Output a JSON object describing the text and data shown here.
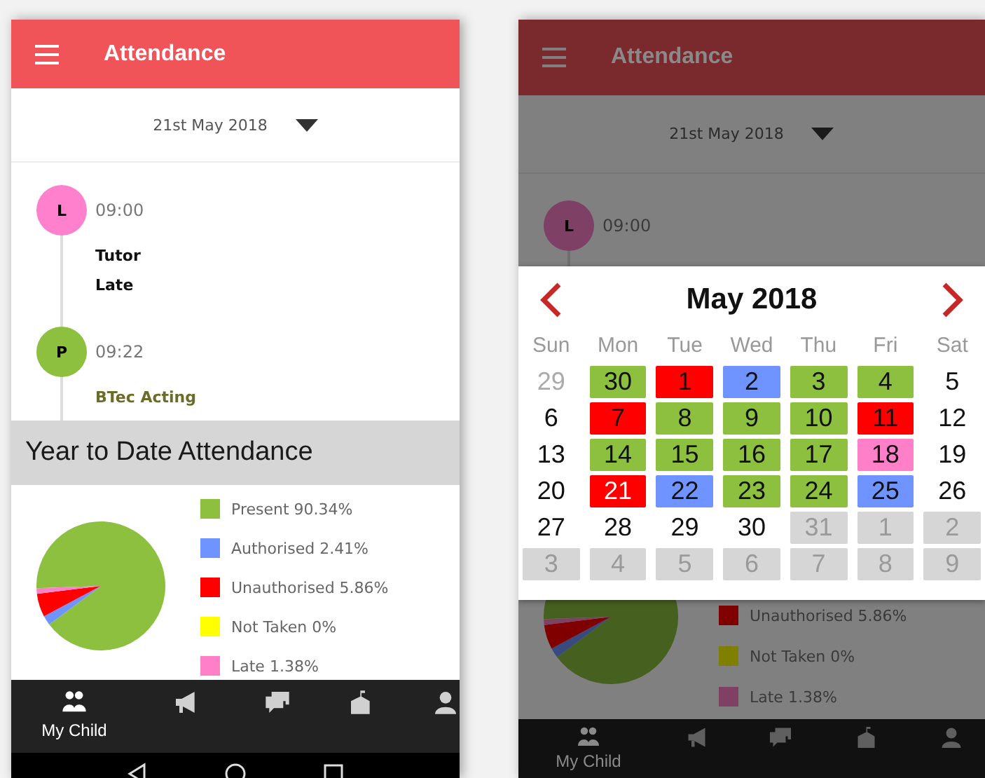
{
  "screens": [
    {
      "dimmed": false,
      "system_nav": true,
      "header": {
        "title": "Attendance"
      },
      "date_picker": {
        "value": "21st May 2018"
      },
      "timeline": [
        {
          "letter": "L",
          "color": "#ff80cc",
          "time": "09:00",
          "details": [
            {
              "kind": "plain",
              "text": "Tutor"
            },
            {
              "kind": "plain",
              "text": "Late"
            }
          ]
        },
        {
          "letter": "P",
          "color": "#8dc03f",
          "time": "09:22",
          "details": [
            {
              "kind": "subject",
              "text": "BTec Acting"
            }
          ]
        }
      ],
      "section_title": "Year to Date Attendance",
      "chart_data": {
        "type": "pie",
        "categories": [
          "Present 90.34%",
          "Authorised 2.41%",
          "Unauthorised 5.86%",
          "Not Taken 0%",
          "Late 1.38%"
        ],
        "values": [
          90.34,
          2.41,
          5.86,
          0,
          1.38
        ]
      },
      "legend": [
        {
          "color": "#8dc03f"
        },
        {
          "color": "#7094ff"
        },
        {
          "color": "#ff0000"
        },
        {
          "color": "#ffff00"
        },
        {
          "color": "#ff80c8"
        }
      ],
      "nav": [
        {
          "kind": "people",
          "label": "My Child",
          "selected": true
        },
        {
          "kind": "megaphone",
          "selected": false
        },
        {
          "kind": "chat",
          "selected": false
        },
        {
          "kind": "school",
          "selected": false
        },
        {
          "kind": "person",
          "selected": false
        }
      ]
    },
    {
      "dimmed": true,
      "system_nav": false,
      "header": {
        "title": "Attendance"
      },
      "date_picker": {
        "value": "21st May 2018"
      },
      "timeline": [
        {
          "letter": "L",
          "color": "#7f4066",
          "time": "09:00"
        }
      ],
      "pie": {
        "kind": "picture"
      },
      "legend": [
        {
          "label": "Unauthorised 5.86%",
          "color": "#800000"
        },
        {
          "label": "Not Taken 0%",
          "color": "#808000"
        },
        {
          "label": "Late 1.38%",
          "color": "#804064"
        }
      ],
      "nav": [
        {
          "kind": "people",
          "label": "My Child",
          "selected": true
        },
        {
          "kind": "megaphone",
          "selected": false
        },
        {
          "kind": "chat",
          "selected": false
        },
        {
          "kind": "school",
          "selected": false
        },
        {
          "kind": "person",
          "selected": false
        }
      ],
      "calendar": {
        "title": "May 2018",
        "weekdays": [
          "Sun",
          "Mon",
          "Tue",
          "Wed",
          "Thu",
          "Fri",
          "Sat"
        ],
        "days": [
          {
            "day": "29",
            "kind": "faded",
            "selected": false
          },
          {
            "day": "30",
            "kind": "marked",
            "color": "#8dc03f",
            "selected": false
          },
          {
            "day": "1",
            "kind": "marked",
            "color": "#ff0000",
            "selected": false
          },
          {
            "day": "2",
            "kind": "marked",
            "color": "#7094ff",
            "selected": false
          },
          {
            "day": "3",
            "kind": "marked",
            "color": "#8dc03f",
            "selected": false
          },
          {
            "day": "4",
            "kind": "marked",
            "color": "#8dc03f",
            "selected": false
          },
          {
            "day": "5",
            "kind": "plain",
            "selected": false
          },
          {
            "day": "6",
            "kind": "plain",
            "selected": false
          },
          {
            "day": "7",
            "kind": "marked",
            "color": "#ff0000",
            "selected": false
          },
          {
            "day": "8",
            "kind": "marked",
            "color": "#8dc03f",
            "selected": false
          },
          {
            "day": "9",
            "kind": "marked",
            "color": "#8dc03f",
            "selected": false
          },
          {
            "day": "10",
            "kind": "marked",
            "color": "#8dc03f",
            "selected": false
          },
          {
            "day": "11",
            "kind": "marked",
            "color": "#ff0000",
            "selected": false
          },
          {
            "day": "12",
            "kind": "plain",
            "selected": false
          },
          {
            "day": "13",
            "kind": "plain",
            "selected": false
          },
          {
            "day": "14",
            "kind": "marked",
            "color": "#8dc03f",
            "selected": false
          },
          {
            "day": "15",
            "kind": "marked",
            "color": "#8dc03f",
            "selected": false
          },
          {
            "day": "16",
            "kind": "marked",
            "color": "#8dc03f",
            "selected": false
          },
          {
            "day": "17",
            "kind": "marked",
            "color": "#8dc03f",
            "selected": false
          },
          {
            "day": "18",
            "kind": "marked",
            "color": "#ff80c8",
            "selected": false
          },
          {
            "day": "19",
            "kind": "plain",
            "selected": false
          },
          {
            "day": "20",
            "kind": "plain",
            "selected": false
          },
          {
            "day": "21",
            "kind": "marked",
            "color": "#ff0000",
            "selected": true
          },
          {
            "day": "22",
            "kind": "marked",
            "color": "#7094ff",
            "selected": false
          },
          {
            "day": "23",
            "kind": "marked",
            "color": "#8dc03f",
            "selected": false
          },
          {
            "day": "24",
            "kind": "marked",
            "color": "#8dc03f",
            "selected": false
          },
          {
            "day": "25",
            "kind": "marked",
            "color": "#7094ff",
            "selected": false
          },
          {
            "day": "26",
            "kind": "plain",
            "selected": false
          },
          {
            "day": "27",
            "kind": "plain",
            "selected": false
          },
          {
            "day": "28",
            "kind": "plain",
            "selected": false
          },
          {
            "day": "29",
            "kind": "plain",
            "selected": false
          },
          {
            "day": "30",
            "kind": "plain",
            "selected": false
          },
          {
            "day": "31",
            "kind": "outside",
            "selected": false
          },
          {
            "day": "1",
            "kind": "outside",
            "selected": false
          },
          {
            "day": "2",
            "kind": "outside",
            "selected": false
          },
          {
            "day": "3",
            "kind": "outside",
            "selected": false
          },
          {
            "day": "4",
            "kind": "outside",
            "selected": false
          },
          {
            "day": "5",
            "kind": "outside",
            "selected": false
          },
          {
            "day": "6",
            "kind": "outside",
            "selected": false
          },
          {
            "day": "7",
            "kind": "outside",
            "selected": false
          },
          {
            "day": "8",
            "kind": "outside",
            "selected": false
          },
          {
            "day": "9",
            "kind": "outside",
            "selected": false
          }
        ]
      }
    }
  ]
}
